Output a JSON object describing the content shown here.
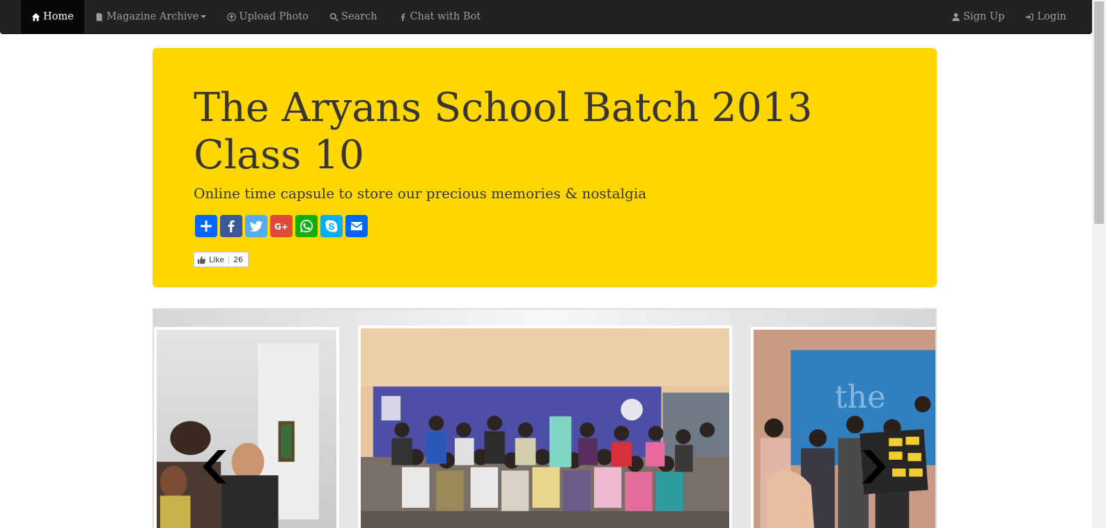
{
  "nav": {
    "left": [
      {
        "label": "Home",
        "icon": "home-icon",
        "active": true
      },
      {
        "label": "Magazine Archive",
        "icon": "file-icon",
        "dropdown": true
      },
      {
        "label": "Upload Photo",
        "icon": "upload-icon"
      },
      {
        "label": "Search",
        "icon": "search-icon"
      },
      {
        "label": "Chat with Bot",
        "icon": "facebook-icon"
      }
    ],
    "right": [
      {
        "label": "Sign Up",
        "icon": "user-icon"
      },
      {
        "label": "Login",
        "icon": "login-icon"
      }
    ]
  },
  "hero": {
    "title_line1": "The Aryans School Batch 2013",
    "title_line2": "Class 10",
    "subtitle": "Online time capsule to store our precious memories & nostalgia",
    "share_buttons": [
      {
        "icon": "share-plus-icon",
        "color": "#0166ff"
      },
      {
        "icon": "facebook-icon",
        "color": "#3b5998"
      },
      {
        "icon": "twitter-icon",
        "color": "#55acee"
      },
      {
        "icon": "google-plus-icon",
        "color": "#dd4b39"
      },
      {
        "icon": "whatsapp-icon",
        "color": "#12af0a"
      },
      {
        "icon": "skype-icon",
        "color": "#00aff0"
      },
      {
        "icon": "email-icon",
        "color": "#0166ff"
      }
    ],
    "like_label": "Like",
    "like_count": "26"
  },
  "carousel": {
    "slides": [
      "group-photo-corridor",
      "group-photo-stage",
      "group-photo-banner"
    ],
    "prev_icon": "chevron-left-icon",
    "next_icon": "chevron-right-icon"
  },
  "colors": {
    "navbar": "#222222",
    "hero_background": "#ffd700",
    "nav_text": "#9d9d9d"
  }
}
